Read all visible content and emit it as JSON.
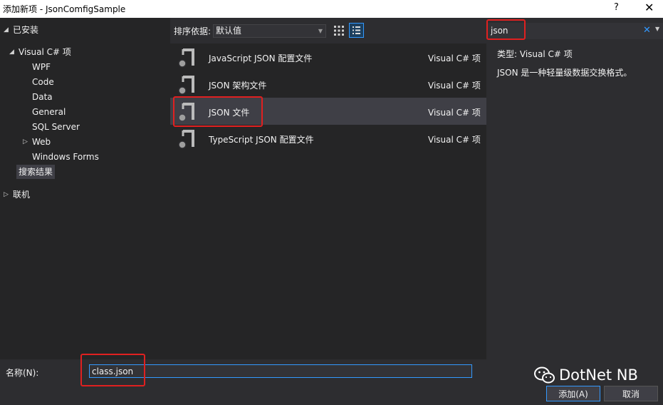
{
  "window": {
    "title": "添加新项 - JsonComfigSample",
    "help_glyph": "?",
    "close_glyph": "✕"
  },
  "tree": {
    "installed": "已安装",
    "visual_csharp": "Visual C# 项",
    "children": [
      "WPF",
      "Code",
      "Data",
      "General",
      "SQL Server",
      "Web",
      "Windows Forms"
    ],
    "search_results": "搜索结果",
    "online": "联机"
  },
  "toolbar": {
    "sort_label": "排序依据:",
    "sort_value": "默认值"
  },
  "items": [
    {
      "name": "JavaScript JSON 配置文件",
      "type": "Visual C# 项"
    },
    {
      "name": "JSON 架构文件",
      "type": "Visual C# 项"
    },
    {
      "name": "JSON 文件",
      "type": "Visual C# 项"
    },
    {
      "name": "TypeScript JSON 配置文件",
      "type": "Visual C# 项"
    }
  ],
  "selected_index": 2,
  "search": {
    "value": "json",
    "clear_glyph": "✕",
    "dropdown_glyph": "▼"
  },
  "details": {
    "type_label": "类型:",
    "type_value": "Visual C# 项",
    "description": "JSON 是一种轻量级数据交换格式。"
  },
  "bottom": {
    "name_label": "名称(N):",
    "name_value": "class.json",
    "add_label": "添加(A)",
    "cancel_label": "取消"
  },
  "watermark": {
    "text": "DotNet NB"
  },
  "colors": {
    "accent": "#3399ff",
    "highlight": "#e02020",
    "background": "#2d2d30",
    "panel": "#252526",
    "selected": "#3f3f46"
  },
  "icons": {
    "item_icon": "json-file-icon",
    "grid": "grid-view-icon",
    "list": "list-view-icon",
    "watermark": "wechat-icon"
  }
}
